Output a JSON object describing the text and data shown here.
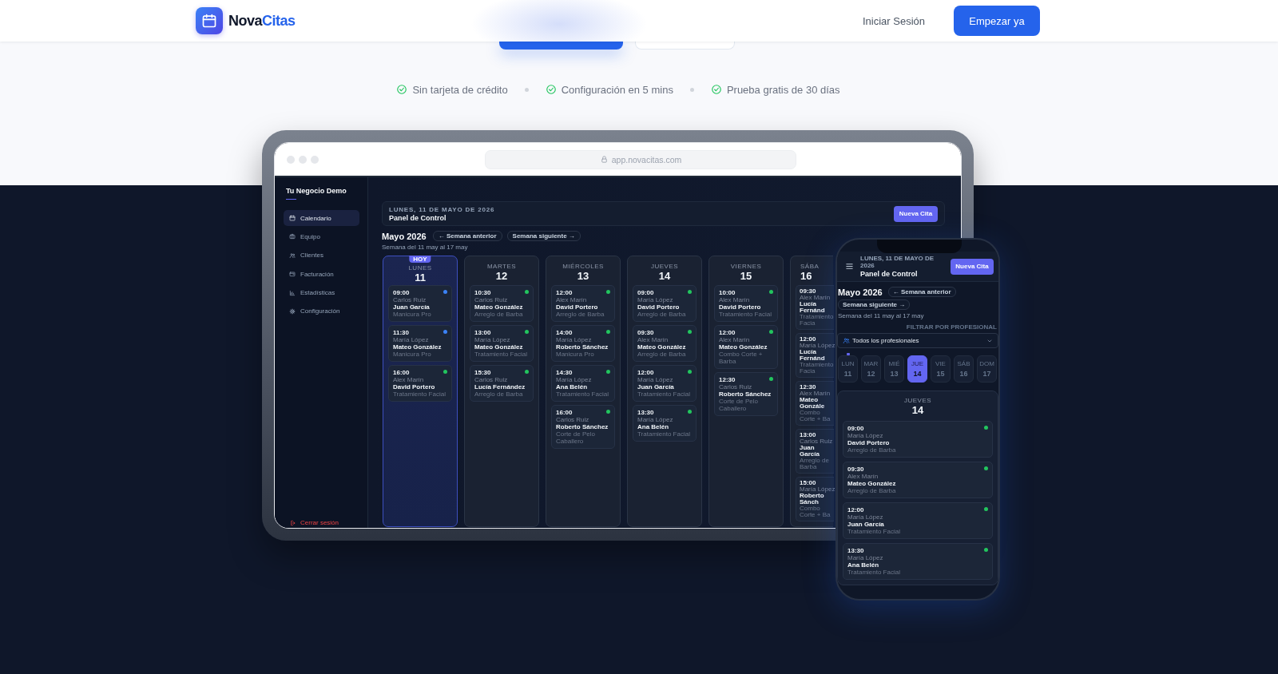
{
  "header": {
    "logo_part_1": "Nova",
    "logo_part_2": "Citas",
    "login_link": "Iniciar Sesión",
    "cta_button": "Empezar ya"
  },
  "features": [
    "Sin tarjeta de crédito",
    "Configuración en 5 mins",
    "Prueba gratis de 30 días"
  ],
  "tablet": {
    "url": "app.novacitas.com",
    "sidebar": {
      "business_name": "Tu Negocio Demo",
      "items": [
        {
          "label": "Calendario",
          "selected": true
        },
        {
          "label": "Equipo",
          "selected": false
        },
        {
          "label": "Clientes",
          "selected": false
        },
        {
          "label": "Facturación",
          "selected": false
        },
        {
          "label": "Estadísticas",
          "selected": false
        },
        {
          "label": "Configuración",
          "selected": false
        }
      ],
      "logout": "Cerrar sesión"
    },
    "topbar": {
      "date": "LUNES, 11 DE MAYO DE 2026",
      "title": "Panel de Control",
      "button": "Nueva Cita"
    },
    "calendar": {
      "month": "Mayo 2026",
      "prev_button": "← Semana anterior",
      "next_button": "Semana siguiente →",
      "range": "Semana del 11 may al 17 may",
      "days": [
        {
          "weekday": "LUNES",
          "day": "11",
          "selected": true,
          "badge": "HOY",
          "appointments": [
            {
              "time": "09:00",
              "staff": "Carlos Ruiz",
              "client": "Juan García",
              "service": "Manicura Pro",
              "color": "#3b82f6"
            },
            {
              "time": "11:30",
              "staff": "María López",
              "client": "Mateo González",
              "service": "Manicura Pro",
              "color": "#3b82f6"
            },
            {
              "time": "16:00",
              "staff": "Alex Marín",
              "client": "David Portero",
              "service": "Tratamiento Facial",
              "color": "#22c55e"
            }
          ]
        },
        {
          "weekday": "MARTES",
          "day": "12",
          "selected": false,
          "appointments": [
            {
              "time": "10:30",
              "staff": "Carlos Ruiz",
              "client": "Mateo González",
              "service": "Arreglo de Barba",
              "color": "#22c55e"
            },
            {
              "time": "13:00",
              "staff": "María López",
              "client": "Mateo González",
              "service": "Tratamiento Facial",
              "color": "#22c55e"
            },
            {
              "time": "15:30",
              "staff": "Carlos Ruiz",
              "client": "Lucía Fernández",
              "service": "Arreglo de Barba",
              "color": "#22c55e"
            }
          ]
        },
        {
          "weekday": "MIÉRCOLES",
          "day": "13",
          "selected": false,
          "appointments": [
            {
              "time": "12:00",
              "staff": "Alex Marín",
              "client": "David Portero",
              "service": "Arreglo de Barba",
              "color": "#22c55e"
            },
            {
              "time": "14:00",
              "staff": "María López",
              "client": "Roberto Sánchez",
              "service": "Manicura Pro",
              "color": "#22c55e"
            },
            {
              "time": "14:30",
              "staff": "María López",
              "client": "Ana Belén",
              "service": "Tratamiento Facial",
              "color": "#22c55e"
            },
            {
              "time": "16:00",
              "staff": "Carlos Ruiz",
              "client": "Roberto Sánchez",
              "service": "Corte de Pelo Caballero",
              "color": "#22c55e"
            }
          ]
        },
        {
          "weekday": "JUEVES",
          "day": "14",
          "selected": false,
          "appointments": [
            {
              "time": "09:00",
              "staff": "María López",
              "client": "David Portero",
              "service": "Arreglo de Barba",
              "color": "#22c55e"
            },
            {
              "time": "09:30",
              "staff": "Alex Marín",
              "client": "Mateo González",
              "service": "Arreglo de Barba",
              "color": "#22c55e"
            },
            {
              "time": "12:00",
              "staff": "María López",
              "client": "Juan García",
              "service": "Tratamiento Facial",
              "color": "#22c55e"
            },
            {
              "time": "13:30",
              "staff": "María López",
              "client": "Ana Belén",
              "service": "Tratamiento Facial",
              "color": "#22c55e"
            }
          ]
        },
        {
          "weekday": "VIERNES",
          "day": "15",
          "selected": false,
          "appointments": [
            {
              "time": "10:00",
              "staff": "Alex Marín",
              "client": "David Portero",
              "service": "Tratamiento Facial",
              "color": "#22c55e"
            },
            {
              "time": "12:00",
              "staff": "Alex Marín",
              "client": "Mateo González",
              "service": "Combo Corte + Barba",
              "color": "#22c55e"
            },
            {
              "time": "12:30",
              "staff": "Carlos Ruiz",
              "client": "Roberto Sánchez",
              "service": "Corte de Pelo Caballero",
              "color": "#22c55e"
            }
          ]
        },
        {
          "weekday": "SÁBA",
          "day": "16",
          "selected": false,
          "appointments": [
            {
              "time": "09:30",
              "staff": "Alex Marín",
              "client": "Lucía Fernánd",
              "service": "Tratamiento Facia"
            },
            {
              "time": "12:00",
              "staff": "María López",
              "client": "Lucía Fernánd",
              "service": "Tratamiento Facia"
            },
            {
              "time": "12:30",
              "staff": "Alex Marín",
              "client": "Mateo Gonzále",
              "service": "Combo Corte + Ba"
            },
            {
              "time": "13:00",
              "staff": "Carlos Ruiz",
              "client": "Juan García",
              "service": "Arreglo de Barba"
            },
            {
              "time": "15:00",
              "staff": "María López",
              "client": "Roberto Sánch",
              "service": "Combo Corte + Ba"
            }
          ]
        }
      ]
    }
  },
  "phone": {
    "topbar": {
      "date": "LUNES, 11 DE MAYO DE 2026",
      "title": "Panel de Control",
      "button": "Nueva Cita"
    },
    "month": "Mayo 2026",
    "prev_button": "← Semana anterior",
    "next_button": "Semana siguiente →",
    "range": "Semana del 11 may al 17 may",
    "filter_label": "FILTRAR POR PROFESIONAL",
    "filter_value": "Todos los profesionales",
    "day_strip": [
      {
        "weekday": "LUN",
        "day": "11",
        "selected": false,
        "today": true
      },
      {
        "weekday": "MAR",
        "day": "12",
        "selected": false,
        "today": false
      },
      {
        "weekday": "MIÉ",
        "day": "13",
        "selected": false,
        "today": false
      },
      {
        "weekday": "JUE",
        "day": "14",
        "selected": true,
        "today": false
      },
      {
        "weekday": "VIE",
        "day": "15",
        "selected": false,
        "today": false
      },
      {
        "weekday": "SÁB",
        "day": "16",
        "selected": false,
        "today": false
      },
      {
        "weekday": "DOM",
        "day": "17",
        "selected": false,
        "today": false
      }
    ],
    "day_panel": {
      "weekday": "JUEVES",
      "day": "14",
      "appointments": [
        {
          "time": "09:00",
          "staff": "María López",
          "client": "David Portero",
          "service": "Arreglo de Barba",
          "color": "#22c55e"
        },
        {
          "time": "09:30",
          "staff": "Alex Marín",
          "client": "Mateo González",
          "service": "Arreglo de Barba",
          "color": "#22c55e"
        },
        {
          "time": "12:00",
          "staff": "María López",
          "client": "Juan García",
          "service": "Tratamiento Facial",
          "color": "#22c55e"
        },
        {
          "time": "13:30",
          "staff": "María López",
          "client": "Ana Belén",
          "service": "Tratamiento Facial",
          "color": "#22c55e"
        }
      ]
    }
  }
}
